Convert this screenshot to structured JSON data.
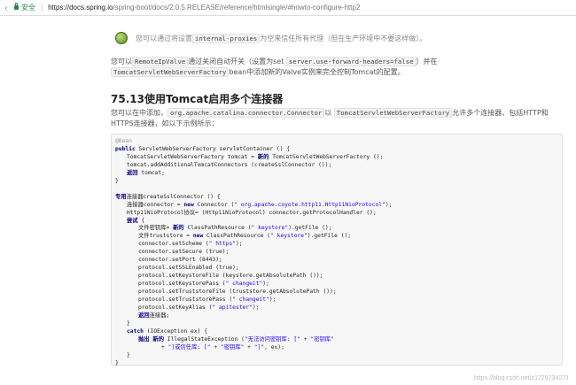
{
  "browser": {
    "secure_label": "安全",
    "separator": "|",
    "url_main": "https://docs.spring.io",
    "url_rest": "/spring-boot/docs/2.0.5.RELEASE/reference/htmlsingle/#howto-configure-http2"
  },
  "note": {
    "text_before": "您可以通过将设置",
    "code": "internal-proxies",
    "text_after": "为空来信任所有代理（但在生产环境中不要这样做）。"
  },
  "para1": {
    "t1": "您可以",
    "c1": "RemoteIpValve",
    "t2": "通过关闭自动开关（设置为set",
    "c2": "server.use-forward-headers=false",
    "t3": "）并在",
    "c3": "TomcatServletWebServerFactory",
    "t4": "bean中添加新的Valve实例来完全控制Tomcat的配置。"
  },
  "heading": "75.13使用Tomcat启用多个连接器",
  "para2": {
    "t1": "您可以在中添加，",
    "c1": "org.apache.catalina.connector.Connector",
    "t2": "以",
    "c2": "TomcatServletWebServerFactory",
    "t3": "允许多个连接器，包括HTTP和HTTPS连接器，如以下示例所示："
  },
  "code_lines": [
    {
      "indent": 0,
      "segments": [
        {
          "t": "@Bean",
          "c": "ann"
        }
      ]
    },
    {
      "indent": 0,
      "segments": [
        {
          "t": "public ",
          "c": "kw"
        },
        {
          "t": "ServletWebServerFactory servletContainer () {",
          "c": ""
        }
      ]
    },
    {
      "indent": 1,
      "segments": [
        {
          "t": "TomcatServletWebServerFactory tomcat = ",
          "c": ""
        },
        {
          "t": "新的",
          "c": "kw"
        },
        {
          "t": " TomcatServletWebServerFactory ();",
          "c": ""
        }
      ]
    },
    {
      "indent": 1,
      "segments": [
        {
          "t": "tomcat.addAdditionalTomcatConnectors (createSslConnector ());",
          "c": ""
        }
      ]
    },
    {
      "indent": 1,
      "segments": [
        {
          "t": "返回",
          "c": "kw"
        },
        {
          "t": " tomcat;",
          "c": ""
        }
      ]
    },
    {
      "indent": 0,
      "segments": [
        {
          "t": "}",
          "c": ""
        }
      ]
    },
    {
      "indent": 0,
      "segments": [
        {
          "t": "",
          "c": ""
        }
      ]
    },
    {
      "indent": 0,
      "segments": [
        {
          "t": "专用",
          "c": "kw"
        },
        {
          "t": "连接器createSslConnector () {",
          "c": ""
        }
      ]
    },
    {
      "indent": 1,
      "segments": [
        {
          "t": "连接器connector = ",
          "c": ""
        },
        {
          "t": "new",
          "c": "kw"
        },
        {
          "t": " Connector (",
          "c": ""
        },
        {
          "t": "\" org.apache.coyote.http11.Http11NioProtocol\"",
          "c": "str"
        },
        {
          "t": ");",
          "c": ""
        }
      ]
    },
    {
      "indent": 1,
      "segments": [
        {
          "t": "Http11NioProtocol协议= (Http11NioProtocol) connector.getProtocolHandler ();",
          "c": ""
        }
      ]
    },
    {
      "indent": 1,
      "segments": [
        {
          "t": "尝试",
          "c": "kw"
        },
        {
          "t": " {",
          "c": ""
        }
      ]
    },
    {
      "indent": 2,
      "segments": [
        {
          "t": "文件密钥库= ",
          "c": ""
        },
        {
          "t": "新的",
          "c": "kw"
        },
        {
          "t": " ClassPathResource (",
          "c": ""
        },
        {
          "t": "\" keystore\"",
          "c": "str"
        },
        {
          "t": ").getFile ();",
          "c": ""
        }
      ]
    },
    {
      "indent": 2,
      "segments": [
        {
          "t": "文件truststore = ",
          "c": ""
        },
        {
          "t": "new",
          "c": "kw"
        },
        {
          "t": " ClassPathResource (",
          "c": ""
        },
        {
          "t": "\" keystore\"",
          "c": "str"
        },
        {
          "t": ").getFile ();",
          "c": ""
        }
      ]
    },
    {
      "indent": 2,
      "segments": [
        {
          "t": "connector.setScheme (",
          "c": ""
        },
        {
          "t": "\" https\"",
          "c": "str"
        },
        {
          "t": ");",
          "c": ""
        }
      ]
    },
    {
      "indent": 2,
      "segments": [
        {
          "t": "connector.setSecure (true);",
          "c": ""
        }
      ]
    },
    {
      "indent": 2,
      "segments": [
        {
          "t": "connector.setPort (8443);",
          "c": ""
        }
      ]
    },
    {
      "indent": 2,
      "segments": [
        {
          "t": "protocol.setSSLEnabled (true);",
          "c": ""
        }
      ]
    },
    {
      "indent": 2,
      "segments": [
        {
          "t": "protocol.setKeystoreFile (keystore.getAbsolutePath ());",
          "c": ""
        }
      ]
    },
    {
      "indent": 2,
      "segments": [
        {
          "t": "protocol.setKeystorePass (",
          "c": ""
        },
        {
          "t": "\" changeit\"",
          "c": "str"
        },
        {
          "t": ");",
          "c": ""
        }
      ]
    },
    {
      "indent": 2,
      "segments": [
        {
          "t": "protocol.setTruststoreFile (truststore.getAbsolutePath ());",
          "c": ""
        }
      ]
    },
    {
      "indent": 2,
      "segments": [
        {
          "t": "protocol.setTruststorePass (",
          "c": ""
        },
        {
          "t": "\" changeit\"",
          "c": "str"
        },
        {
          "t": ");",
          "c": ""
        }
      ]
    },
    {
      "indent": 2,
      "segments": [
        {
          "t": "protocol.setKeyAlias (",
          "c": ""
        },
        {
          "t": "\" apitester\"",
          "c": "str"
        },
        {
          "t": ");",
          "c": ""
        }
      ]
    },
    {
      "indent": 2,
      "segments": [
        {
          "t": "返回",
          "c": "kw"
        },
        {
          "t": "连接器;",
          "c": ""
        }
      ]
    },
    {
      "indent": 1,
      "segments": [
        {
          "t": "}",
          "c": ""
        }
      ]
    },
    {
      "indent": 1,
      "segments": [
        {
          "t": "catch",
          "c": "kw"
        },
        {
          "t": " (IOException ex) {",
          "c": ""
        }
      ]
    },
    {
      "indent": 2,
      "segments": [
        {
          "t": "抛出",
          "c": "kw"
        },
        {
          "t": " ",
          "c": ""
        },
        {
          "t": "新的",
          "c": "kw"
        },
        {
          "t": " IllegalStateException (",
          "c": ""
        },
        {
          "t": "\"无法访问密钥库: [\"",
          "c": "str"
        },
        {
          "t": " + ",
          "c": ""
        },
        {
          "t": "\"密钥库\"",
          "c": "str"
        }
      ]
    },
    {
      "indent": 4,
      "segments": [
        {
          "t": "+ ",
          "c": ""
        },
        {
          "t": "\"]或信任库: [\"",
          "c": "str"
        },
        {
          "t": " + ",
          "c": ""
        },
        {
          "t": "\"密钥库\"",
          "c": "str"
        },
        {
          "t": " + ",
          "c": ""
        },
        {
          "t": "\"]\"",
          "c": "str"
        },
        {
          "t": ", ex);",
          "c": ""
        }
      ]
    },
    {
      "indent": 1,
      "segments": [
        {
          "t": "}",
          "c": ""
        }
      ]
    },
    {
      "indent": 0,
      "segments": [
        {
          "t": "}",
          "c": ""
        }
      ]
    }
  ],
  "watermark": "https://blog.csdn.net/z1729734271"
}
